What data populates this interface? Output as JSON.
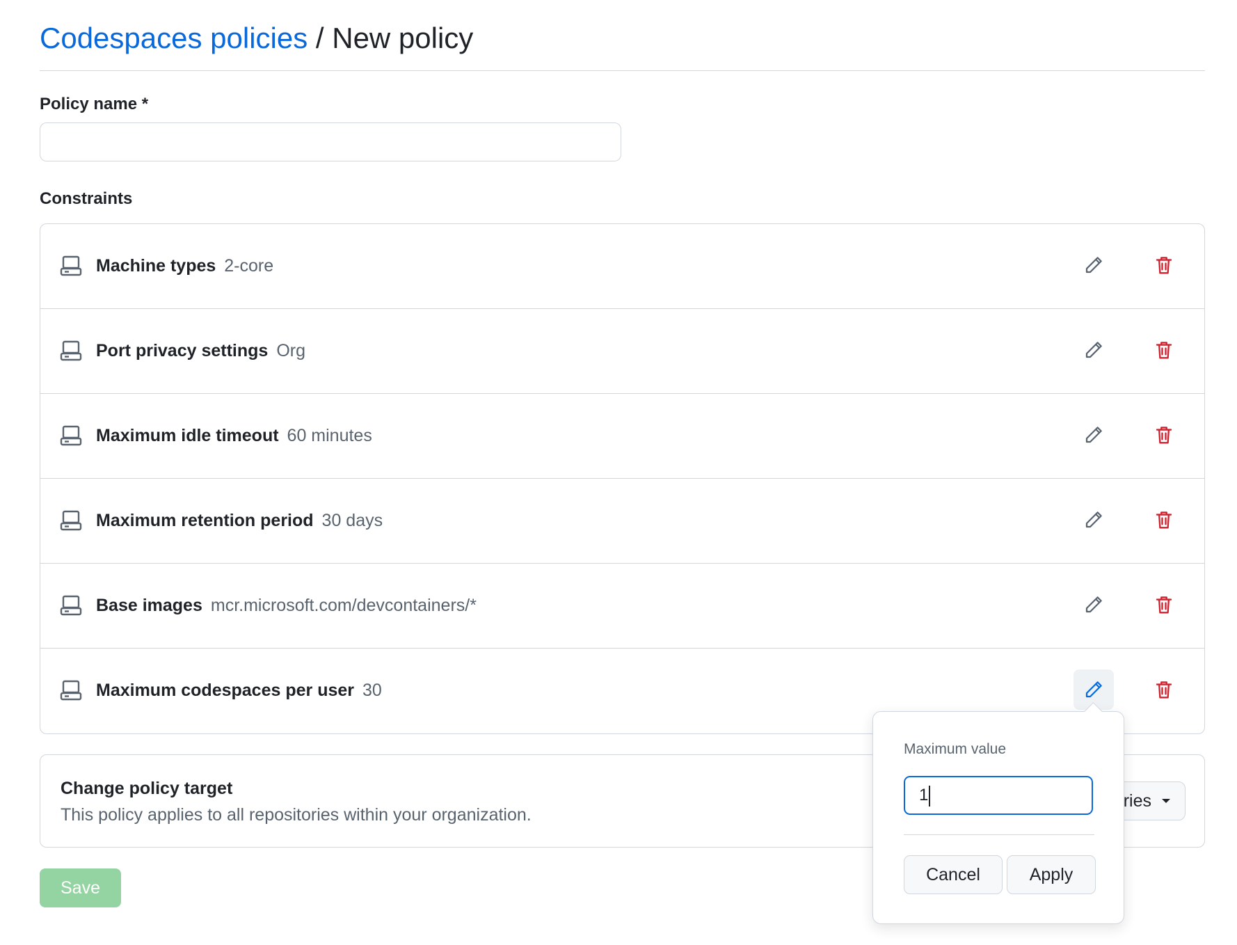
{
  "header": {
    "breadcrumb_link": "Codespaces policies",
    "separator": "/",
    "current": "New policy"
  },
  "form": {
    "policy_name_label": "Policy name *",
    "policy_name_value": "",
    "constraints_label": "Constraints"
  },
  "constraints": [
    {
      "name": "Machine types",
      "value": "2-core",
      "icon": "server-icon"
    },
    {
      "name": "Port privacy settings",
      "value": "Org",
      "icon": "server-icon"
    },
    {
      "name": "Maximum idle timeout",
      "value": "60 minutes",
      "icon": "server-icon"
    },
    {
      "name": "Maximum retention period",
      "value": "30 days",
      "icon": "server-icon"
    },
    {
      "name": "Base images",
      "value": "mcr.microsoft.com/devcontainers/*",
      "icon": "server-icon"
    },
    {
      "name": "Maximum codespaces per user",
      "value": "30",
      "icon": "server-icon"
    }
  ],
  "target": {
    "title": "Change policy target",
    "description": "This policy applies to all repositories within your organization.",
    "button_label_visible": "ries"
  },
  "save_label": "Save",
  "popover": {
    "label": "Maximum value",
    "input_value": "1",
    "cancel_label": "Cancel",
    "apply_label": "Apply"
  },
  "colors": {
    "link": "#0969da",
    "danger": "#cf222e",
    "save_disabled": "#94d3a2",
    "muted": "#59636e",
    "border": "#d0d7de"
  }
}
